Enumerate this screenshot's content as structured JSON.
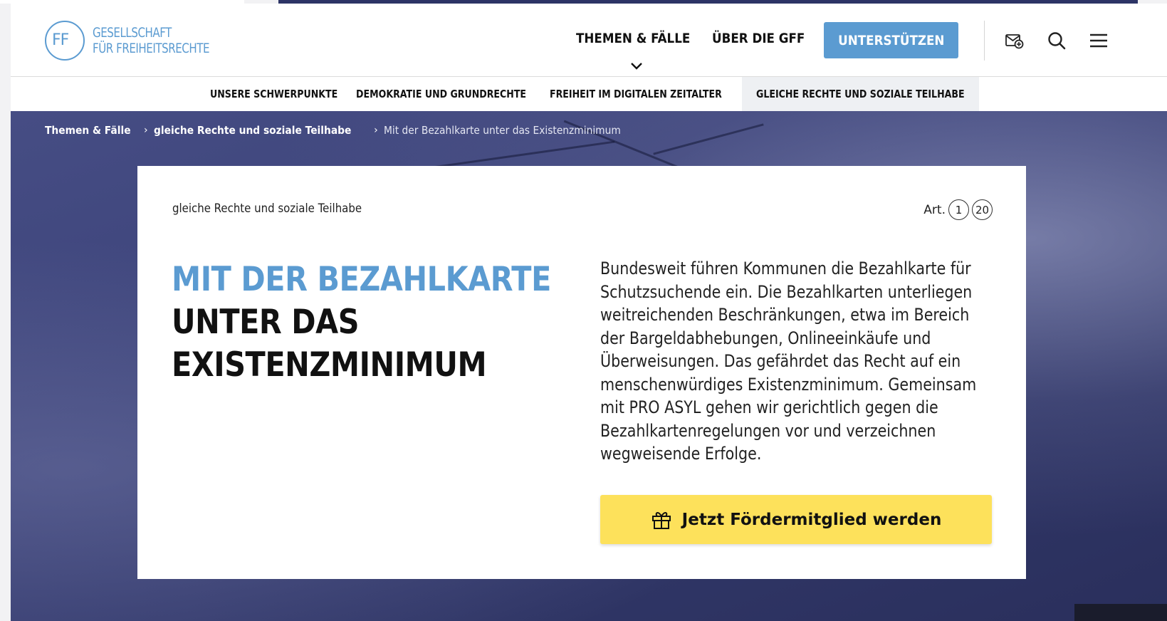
{
  "logo": {
    "mark": "FF",
    "line1": "GESELLSCHAFT",
    "line2": "FÜR FREIHEITSRECHTE"
  },
  "nav": {
    "themes": "THEMEN & FÄLLE",
    "about": "ÜBER DIE GFF",
    "support": "UNTERSTÜTZEN"
  },
  "subnav": [
    "UNSERE SCHWERPUNKTE",
    "DEMOKRATIE UND GRUNDRECHTE",
    "FREIHEIT IM DIGITALEN ZEITALTER",
    "GLEICHE RECHTE UND SOZIALE TEILHABE"
  ],
  "breadcrumb": {
    "level1": "Themen & Fälle",
    "level2": "gleiche Rechte und soziale Teilhabe",
    "current": "Mit der Bezahlkarte unter das Existenzminimum"
  },
  "card": {
    "topic": "gleiche Rechte und soziale Teilhabe",
    "art_label": "Art.",
    "articles": [
      "1",
      "20"
    ],
    "headline_line1": "MIT DER BEZAHLKARTE",
    "headline_line2": "UNTER DAS",
    "headline_line3": "EXISTENZMINIMUM",
    "lead_lines": [
      "Bundesweit führen Kommunen die Bezahlkarte für",
      "Schutzsuchende ein. Die Bezahlkarten unterliegen",
      "weitreichenden Beschränkungen, etwa im Bereich",
      "der Bargeldabhebungen, Onlineeinkäufe und",
      "Überweisungen. Das gefährdet das Recht auf ein",
      "menschenwürdiges Existenzminimum. Gemeinsam",
      "mit PRO ASYL gehen wir gerichtlich gegen die",
      "Bezahlkartenregelungen vor und verzeichnen",
      "wegweisende Erfolge."
    ],
    "cta": "Jetzt Fördermitglied werden"
  },
  "colors": {
    "brand_blue": "#5b9bd1",
    "cta_yellow": "#fde15b",
    "hero_navy": "#3b4279"
  },
  "icons": [
    "newsletter-icon",
    "search-icon",
    "menu-icon",
    "chevron-down-icon",
    "gift-icon"
  ]
}
